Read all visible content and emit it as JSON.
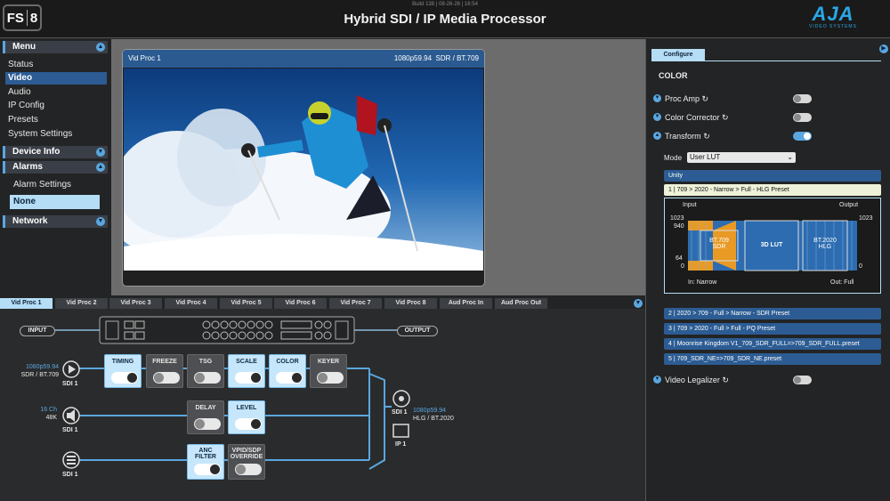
{
  "header": {
    "logo_text": "FS",
    "logo_num": "8",
    "build": "Build 138 | 08-26-26 | 16:54",
    "title": "Hybrid SDI / IP Media Processor",
    "brand": "AJA",
    "brand_sub": "VIDEO SYSTEMS"
  },
  "sidebar": {
    "menu": "Menu",
    "items": [
      "Status",
      "Video",
      "Audio",
      "IP Config",
      "Presets",
      "System Settings"
    ],
    "device_info": "Device Info",
    "alarms": "Alarms",
    "alarm_settings": "Alarm Settings",
    "alarm_value": "None",
    "network": "Network"
  },
  "preview": {
    "title": "Vid Proc 1",
    "format": "1080p59.94",
    "range": "SDR / BT.709"
  },
  "tabs": [
    "Vid Proc 1",
    "Vid Proc 2",
    "Vid Proc 3",
    "Vid Proc 4",
    "Vid Proc 5",
    "Vid Proc 6",
    "Vid Proc 7",
    "Vid Proc 8",
    "Aud Proc In",
    "Aud Proc Out"
  ],
  "routing": {
    "input": "INPUT",
    "output": "OUTPUT",
    "video_in": {
      "fmt": "1080p59.94",
      "range": "SDR / BT.709",
      "port": "SDI 1"
    },
    "audio_in": {
      "ch": "16 Ch",
      "rate": "48K",
      "port": "SDI 1"
    },
    "anc_in": {
      "port": "SDI 1"
    },
    "blocks": {
      "timing": "TIMING",
      "freeze": "FREEZE",
      "tsg": "TSG",
      "scale": "SCALE",
      "color": "COLOR",
      "keyer": "KEYER",
      "delay": "DELAY",
      "level": "LEVEL",
      "anc1": "ANC",
      "anc2": "FILTER",
      "vpid1": "VPID/SDP",
      "vpid2": "OVERRIDE"
    },
    "out": {
      "port": "SDI 1",
      "fmt": "1080p59.94",
      "range": "HLG / BT.2020",
      "ip": "IP 1"
    }
  },
  "config": {
    "tab": "Configure",
    "section": "COLOR",
    "proc_amp": "Proc Amp",
    "color_corrector": "Color Corrector",
    "transform": "Transform",
    "mode_label": "Mode",
    "mode_value": "User LUT",
    "luts": [
      "Unity",
      "1 | 709 > 2020 - Narrow > Full - HLG Preset",
      "2 | 2020 > 709 - Full > Narrow - SDR Preset",
      "3 | 709 > 2020 - Full > Full - PQ Preset",
      "4 | Moonrise Kingdom V1_709_SDR_FULL=>709_SDR_FULL.preset",
      "5 | 709_SDR_NE=>709_SDR_NE.preset"
    ],
    "graph": {
      "input": "Input",
      "output": "Output",
      "y1023": "1023",
      "y940": "940",
      "y64": "64",
      "y0": "0",
      "in_mode": "In: Narrow",
      "out_mode": "Out: Full",
      "box1a": "BT.709",
      "box1b": "SDR",
      "box2": "3D LUT",
      "box3a": "BT.2020",
      "box3b": "HLG"
    },
    "video_legalizer": "Video Legalizer"
  }
}
